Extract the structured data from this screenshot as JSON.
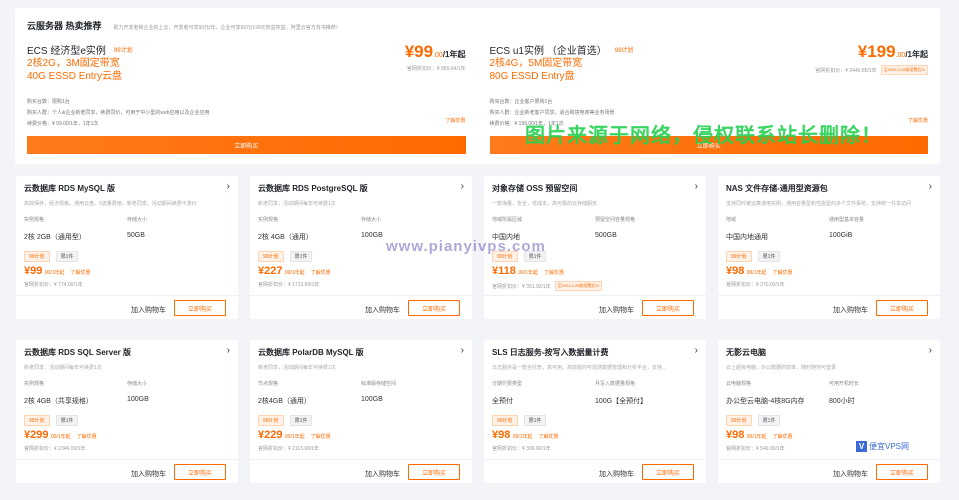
{
  "top": {
    "title": "云服务器 热卖推荐",
    "subtitle": "助力开发者和企业的上云，开发者可享99元/年，企业可享99元/199元权益权益，阿里云官方背书推荐！",
    "offers": [
      {
        "name": "ECS 经济型e实例",
        "tag": "99计划",
        "spec1": "2核2G，3M固定带宽",
        "spec2": "40G ESSD Entry云盘",
        "price": "¥99",
        "unit": ".00",
        "suffix": "/1年起",
        "orig": "官网折扣价：¥ 955.64/1年",
        "badge": "",
        "info1": "购买台数：限购1台",
        "info2": "购买人群：个人&企业新老同享，续费同价，可用于中小型的web应用以及企业应用",
        "info3": "续费价格：¥ 99.00/1年，1年1次",
        "link": "了解优惠",
        "buy": "立即购买"
      },
      {
        "name": "ECS u1实例 （企业首选）",
        "tag": "99计划",
        "spec1": "2核4G，5M固定带宽",
        "spec2": "80G ESSD Entry盘",
        "price": "¥199",
        "unit": ".00",
        "suffix": "/1年起",
        "orig": "官网折扣价：¥ 2440.85/1年",
        "badge": "至2024.3.28前续费后%",
        "info1": "购买台数：企业客户限购1台",
        "info2": "购买人群：企业新老客户同享，适合跨境电商等业务场景",
        "info3": "续费价格：¥ 199.00/1年，1年1次",
        "link": "了解优惠",
        "buy": "立即购买"
      }
    ]
  },
  "cards": [
    {
      "title": "云数据库 RDS MySQL 版",
      "desc": "高效保存，经济规格，通用云盘，0流量费用，新老同享，活动期间续费不涨价",
      "f1_label": "实例规格",
      "f1_value": "2核 2GB（通用型）",
      "f2_label": "存储大小",
      "f2_value": "50GB",
      "tag1": "99计划",
      "tag2": "限1件",
      "price": "¥99",
      "unit": ".00/1年起",
      "more": "了解优惠",
      "orig": "官网折扣价：¥ 774.00/1年",
      "badge": "",
      "cart": "加入购物车",
      "buy": "立即购买"
    },
    {
      "title": "云数据库 RDS PostgreSQL 版",
      "desc": "新老同享，活动期间每年可续费1次",
      "f1_label": "实例规格",
      "f1_value": "2核 4GB（通用）",
      "f2_label": "存储大小",
      "f2_value": "100GB",
      "tag1": "99计划",
      "tag2": "限1件",
      "price": "¥227",
      "unit": ".99/1年起",
      "more": "了解优惠",
      "orig": "官网折扣价：¥ 1713.60/1年",
      "badge": "",
      "cart": "加入购物车",
      "buy": "立即购买"
    },
    {
      "title": "对象存储 OSS 预留空间",
      "desc": "一款海量，安全，低成本，高可靠的云存储服务",
      "f1_label": "地域所属区域",
      "f1_value": "中国内地",
      "f2_label": "预留空间容量规格",
      "f2_value": "500GB",
      "tag1": "99计划",
      "tag2": "限1件",
      "price": "¥118",
      "unit": ".99/1年起",
      "more": "了解优惠",
      "orig": "官网折扣价：¥ 351.00/1年",
      "badge": "至2024.3.28前续费后%",
      "cart": "加入购物车",
      "buy": "立即购买"
    },
    {
      "title": "NAS 文件存储-通用型资源包",
      "desc": "支持同时被运算通用实例，通用容量型和性能型的多个文件系统，支持统一共享访问",
      "f1_label": "地域",
      "f1_value": "中国内地通用",
      "f2_label": "通用型基本容量",
      "f2_value": "100GiB",
      "tag1": "99计划",
      "tag2": "限1件",
      "price": "¥98",
      "unit": ".99/1年起",
      "more": "了解优惠",
      "orig": "官网折扣价：¥ 370.00/1年",
      "badge": "",
      "cart": "加入购物车",
      "buy": "立即购买"
    },
    {
      "title": "云数据库 RDS SQL Server 版",
      "desc": "新老同享，活动期间每年可续费1次",
      "f1_label": "实例规格",
      "f1_value": "2核 4GB（共享规格）",
      "f2_label": "存储大小",
      "f2_value": "100GB",
      "tag1": "99计划",
      "tag2": "限1件",
      "price": "¥299",
      "unit": ".00/1年起",
      "more": "了解优惠",
      "orig": "官网折扣价：¥ 2346.00/1年",
      "badge": "",
      "cart": "加入购物车",
      "buy": "立即购买"
    },
    {
      "title": "云数据库 PolarDB MySQL 版",
      "desc": "新老同享，活动期间每年可续费1次",
      "f1_label": "节点规格",
      "f1_value": "2核4GB（通用）",
      "f2_label": "标准版存储空间",
      "f2_value": "100GB",
      "tag1": "99计划",
      "tag2": "限1件",
      "price": "¥229",
      "unit": ".00/1年起",
      "more": "了解优惠",
      "orig": "官网折扣价：¥ 2113.00/1年",
      "badge": "",
      "cart": "加入购物车",
      "buy": "立即购买"
    },
    {
      "title": "SLS 日志服务-按写入数据量计费",
      "desc": "日志服务是一款全托管，高可用，高效能的可观测数据管理和分析平台，支持...",
      "f1_label": "分期付费类型",
      "f1_value": "全预付",
      "f2_label": "月写入数据量规格",
      "f2_value": "100G【全预付】",
      "tag1": "99计划",
      "tag2": "限1件",
      "price": "¥98",
      "unit": ".99/1年起",
      "more": "了解优惠",
      "orig": "官网折扣价：¥ 306.60/1年",
      "badge": "",
      "cart": "加入购物车",
      "buy": "立即购买"
    },
    {
      "title": "无影云电脑",
      "desc": "云上超级电脑，办公数据的效率，随时随地可登录",
      "f1_label": "云电脑规格",
      "f1_value": "办公型云电脑-4核8G内存",
      "f2_label": "可用开机时长",
      "f2_value": "800小时",
      "tag1": "99计划",
      "tag2": "限1件",
      "price": "¥98",
      "unit": ".99/1年起",
      "more": "了解优惠",
      "orig": "官网折扣价：¥ 549.00/1年",
      "badge": "",
      "cart": "加入购物车",
      "buy": "立即购买"
    }
  ],
  "watermark_main": "图片来源于网络，侵权联系站长删除！",
  "watermark_site": "www.pianyivps.com",
  "logo_text": "便宜VPS网",
  "logo_letter": "V"
}
